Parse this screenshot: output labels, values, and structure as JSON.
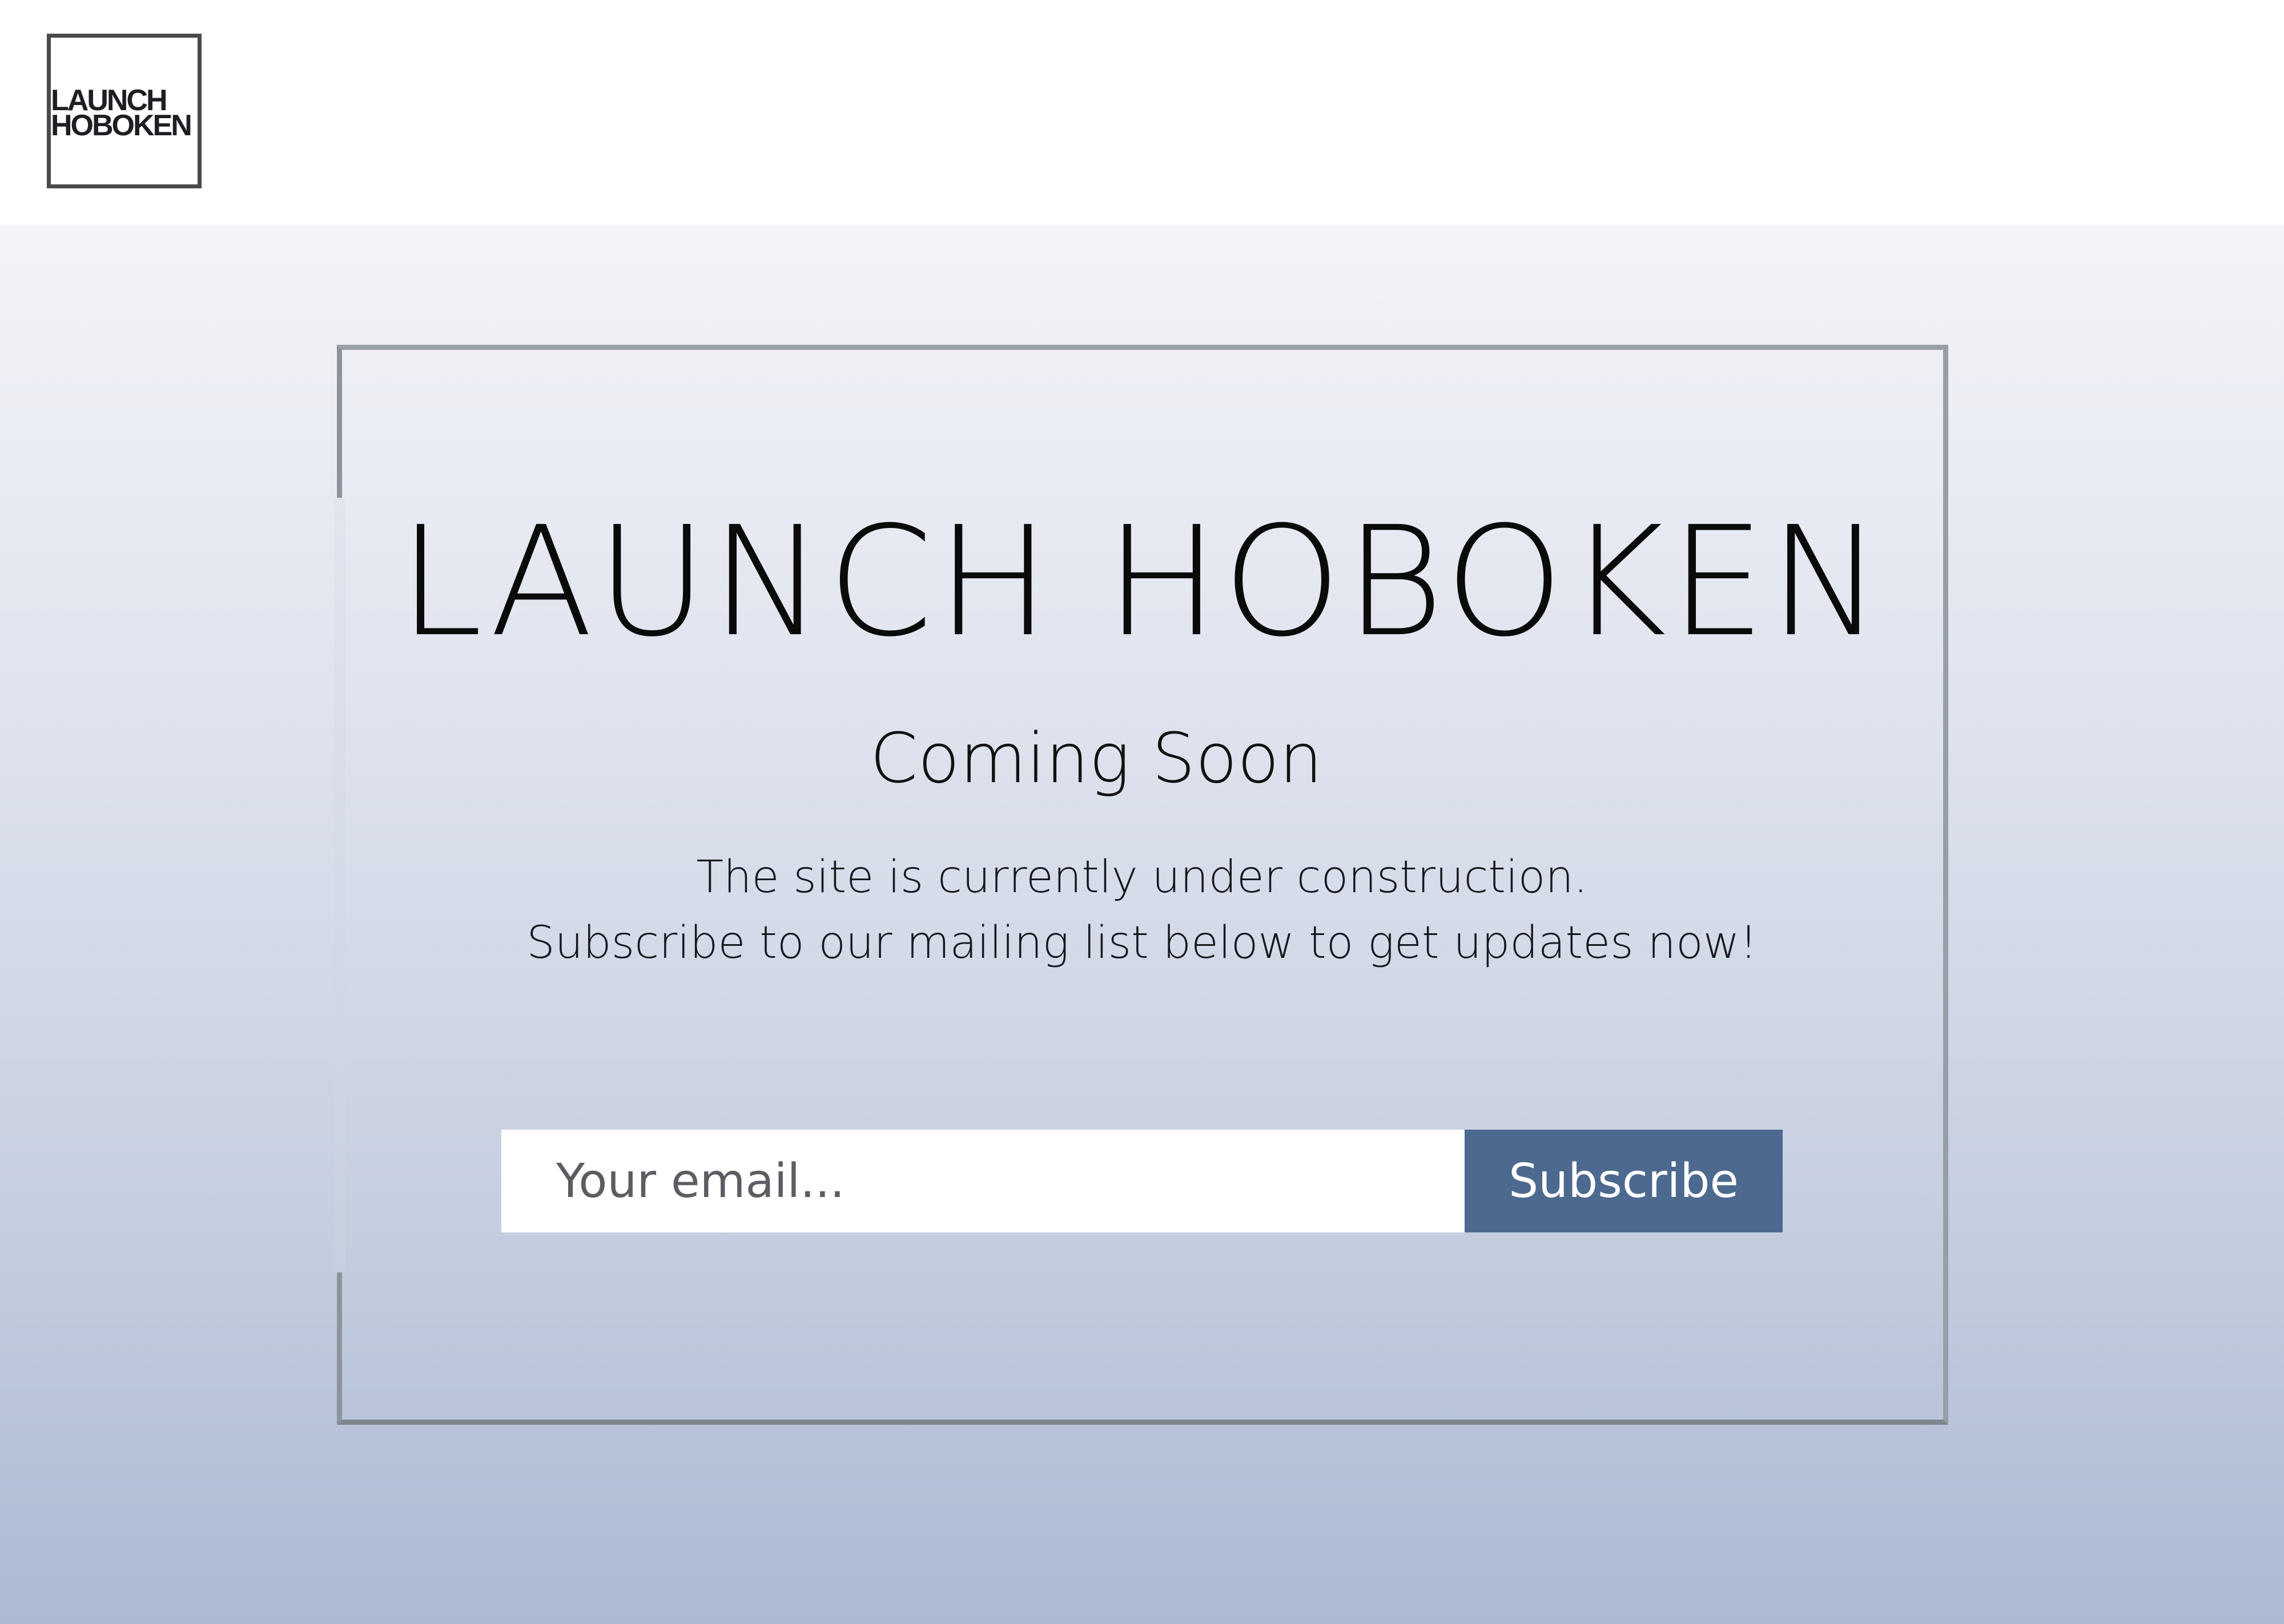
{
  "logo": {
    "line1": "LAUNCH",
    "line2": "HOBOKEN"
  },
  "hero": {
    "title": "LAUNCH HOBOKEN",
    "subtitle": "Coming Soon",
    "description_line1": "The site is currently under construction.",
    "description_line2": "Subscribe to our mailing list below to get updates now!"
  },
  "subscribe_form": {
    "email_placeholder": "Your email...",
    "email_value": "",
    "button_label": "Subscribe"
  },
  "colors": {
    "button": "#4d698f",
    "frame": "#9aa0a8",
    "gradient_top": "#f3f4f8",
    "gradient_bottom": "#abb9d2"
  }
}
